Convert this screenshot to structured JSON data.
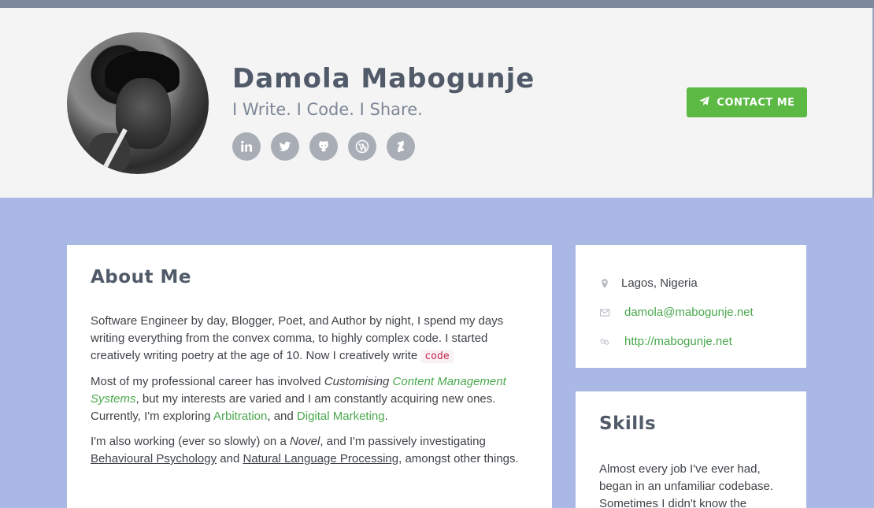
{
  "header": {
    "name": "Damola Mabogunje",
    "tagline": "I Write. I Code. I Share.",
    "contact_button": "CONTACT ME",
    "socials": [
      {
        "icon": "linkedin-icon"
      },
      {
        "icon": "twitter-icon"
      },
      {
        "icon": "github-icon"
      },
      {
        "icon": "wordpress-icon"
      },
      {
        "icon": "deviantart-icon"
      }
    ],
    "accent_color": "#5cb944"
  },
  "about": {
    "title": "About Me",
    "p1_text": "Software Engineer by day, Blogger, Poet, and Author by night, I spend my days writing everything from the convex comma, to highly complex code. I started creatively writing poetry at the age of 10. Now I creatively write",
    "p1_code": "code",
    "p2_a": "Most of my professional career has involved",
    "p2_em": "Customising",
    "p2_link": "Content Management Systems",
    "p2_b": ", but my interests are varied and I am constantly acquiring new ones. Currently, I'm exploring",
    "p2_link2": "Arbitration",
    "p2_c": ", and",
    "p2_link3": "Digital Marketing",
    "p2_d": ".",
    "p3_a": "I'm also working (ever so slowly) on a",
    "p3_em": "Novel",
    "p3_b": ", and I'm passively investigating",
    "p3_link1": "Behavioural Psychology",
    "p3_c": "and",
    "p3_link2": "Natural Language Processing",
    "p3_d": ", amongst other things."
  },
  "contact": {
    "location": "Lagos, Nigeria",
    "email": "damola@mabogunje.net",
    "website": "http://mabogunje.net"
  },
  "skills": {
    "title": "Skills",
    "text": "Almost every job I've ever had, began in an unfamiliar codebase. Sometimes I didn't know the"
  }
}
